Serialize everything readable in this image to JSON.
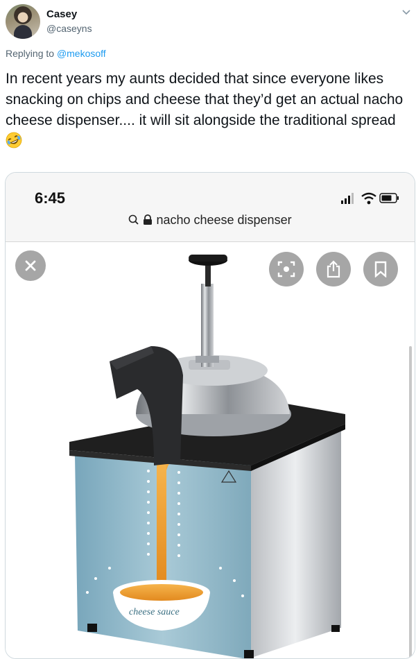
{
  "tweet": {
    "author_name": "Casey",
    "author_handle": "@caseyns",
    "replying_prefix": "Replying to",
    "replying_to": "@mekosoff",
    "text": "In recent years my aunts decided that since everyone likes snacking on chips and cheese that they’d get an actual nacho cheese dispenser.... it will sit alongside the traditional spread",
    "emoji": "rolling-on-floor-laughing-emoji"
  },
  "embedded_screenshot": {
    "status_time": "6:45",
    "search_query": "nacho cheese dispenser",
    "product_label": "cheese sauce",
    "icons": [
      "close-icon",
      "visual-search-icon",
      "share-icon",
      "bookmark-icon"
    ]
  },
  "colors": {
    "link": "#1d9bf0",
    "secondary_text": "#536471",
    "cheese": "#f0a43a",
    "panel_blue": "#8fb7c8"
  }
}
